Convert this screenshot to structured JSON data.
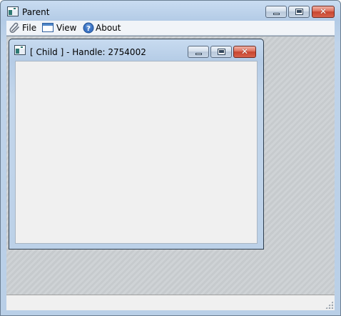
{
  "window": {
    "title": "Parent",
    "icon": "app-window-icon"
  },
  "caption_buttons": {
    "minimize": "minimize-icon",
    "maximize": "maximize-icon",
    "close": "✕"
  },
  "menu": {
    "items": [
      {
        "label": "File",
        "icon": "paperclip-icon"
      },
      {
        "label": "View",
        "icon": "window-icon"
      },
      {
        "label": "About",
        "icon": "help-icon"
      }
    ]
  },
  "child_window": {
    "title": "[ Child ] - Handle: 2754002"
  },
  "statusbar": {
    "text": ""
  },
  "colors": {
    "accent": "#b3cbe6",
    "close_button": "#c7452f",
    "client": "#f0f0f0"
  }
}
